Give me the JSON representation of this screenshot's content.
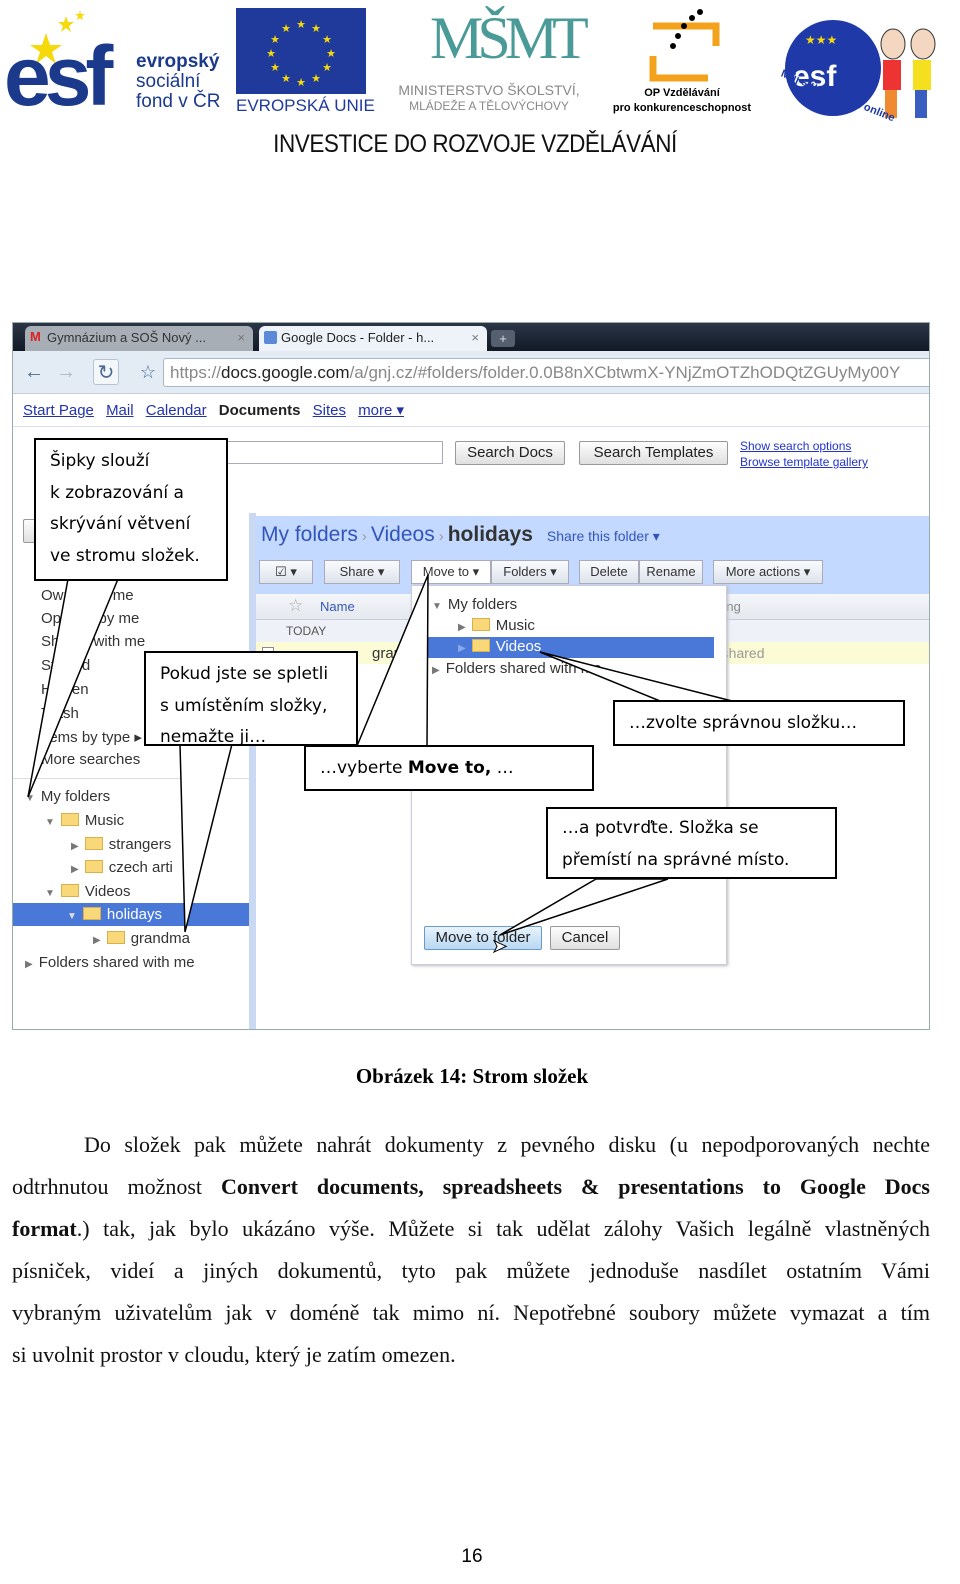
{
  "header": {
    "logos": [
      {
        "name": "esf",
        "text": "esf",
        "subtitle_lines": [
          "evropský",
          "sociální",
          "fond v ČR"
        ]
      },
      {
        "name": "eu",
        "caption": "EVROPSKÁ UNIE"
      },
      {
        "name": "msmt",
        "text": "MŠMT",
        "caption_lines": [
          "MINISTERSTVO ŠKOLSTVÍ,",
          "MLÁDEŽE A TĚLOVÝCHOVY"
        ]
      },
      {
        "name": "op",
        "caption_lines": [
          "OP Vzdělávání",
          "pro konkurenceschopnost"
        ]
      },
      {
        "name": "esf-online",
        "text": "esf",
        "caption": "Můj studijní svět online"
      }
    ],
    "title": "INVESTICE DO ROZVOJE  VZDĚLÁVÁNÍ"
  },
  "browser": {
    "tabs": [
      {
        "label": "Gymnázium a SOŠ Nový ...",
        "active": false
      },
      {
        "label": "Google Docs - Folder - h...",
        "active": true
      }
    ],
    "new_tab": "+",
    "url_prefix": "https://",
    "url_domain": "docs.google.com",
    "url_rest": "/a/gnj.cz/#folders/folder.0.0B8nXCbtwmX-YNjZmOTZhODQtZGUyMy00Y",
    "nav_links": [
      "Start Page",
      "Mail",
      "Calendar",
      "Documents",
      "Sites",
      "more ▾"
    ],
    "search_docs": "Search Docs",
    "search_templates": "Search Templates",
    "show_search_options": "Show search options",
    "browse_template_gallery": "Browse template gallery",
    "sidebar": {
      "items": [
        "Owned by me",
        "Opened by me",
        "Shared with me",
        "Starred",
        "Hidden",
        "Trash",
        "Items by type ▸",
        "More searches"
      ],
      "tree": [
        "My folders",
        "Music",
        "strangers",
        "czech arti",
        "Videos",
        "holidays",
        "grandma",
        "Folders shared with me"
      ]
    },
    "breadcrumb": [
      "My folders",
      "Videos",
      "holidays"
    ],
    "share_folder": "Share this folder ▾",
    "toolbar": [
      "☑ ▾",
      "Share ▾",
      "Move to ▾",
      "Folders ▾",
      "Delete",
      "Rename",
      "More actions ▾"
    ],
    "columns": {
      "name": "Name",
      "sharing": "Sharing"
    },
    "group": "TODAY",
    "file_row": {
      "name": "grandma",
      "sharing": "Not shared"
    },
    "move_dialog": {
      "tree": [
        "My folders",
        "Music",
        "Videos",
        "Folders shared with me"
      ],
      "selected": "Videos",
      "move_button": "Move to folder",
      "cancel_button": "Cancel"
    }
  },
  "callouts": {
    "arrows": [
      "Šipky slouží",
      "k zobrazování a",
      "skrývání větvení",
      "ve stromu složek."
    ],
    "undo": [
      "Pokud jste se spletli",
      "s umístěním složky,",
      "nemažte ji…"
    ],
    "move_pre": "…vyberte ",
    "move_bold": "Move to,",
    "move_post": " …",
    "choose": "…zvolte správnou složku…",
    "confirm": [
      "…a potvrďte. Složka se",
      "přemístí na správné místo."
    ]
  },
  "caption": "Obrázek 14: Strom složek",
  "paragraph": [
    [
      {
        "t": "Do složek pak můžete nahrát dokumenty z pevného disku (u nepodporovaných nechte"
      }
    ],
    [
      {
        "t": "odtrhnutou možnost "
      },
      {
        "t": "Convert documents, spreadsheets & presentations to Google Docs",
        "b": true
      }
    ],
    [
      {
        "t": "format",
        "b": true
      },
      {
        "t": ".) tak, jak bylo ukázáno výše. Můžete si tak udělat zálohy Vašich legálně vlastněných"
      }
    ],
    [
      {
        "t": "písniček, videí a jiných dokumentů, tyto pak můžete jednoduše nasdílet ostatním Vámi"
      }
    ],
    [
      {
        "t": "vybraným uživatelům jak v doméně tak mimo ní. Nepotřebné soubory můžete vymazat a tím"
      }
    ],
    [
      {
        "t": "si uvolnit prostor v cloudu, který je zatím omezen."
      }
    ]
  ],
  "page_number": "16",
  "colors": {
    "esf_blue": "#1b3a8c",
    "eu_blue": "#1f3a9a",
    "msmt_teal": "#4a9a98",
    "op_orange": "#f4a21c",
    "selection": "#4a78d8",
    "header_band": "#c3d9ff"
  }
}
